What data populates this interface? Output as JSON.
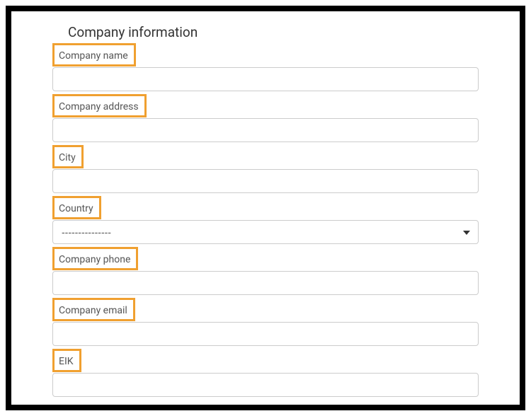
{
  "form": {
    "title": "Company information",
    "fields": {
      "company_name": {
        "label": "Company name",
        "value": ""
      },
      "company_address": {
        "label": "Company address",
        "value": ""
      },
      "city": {
        "label": "City",
        "value": ""
      },
      "country": {
        "label": "Country",
        "selected": "---------------"
      },
      "company_phone": {
        "label": "Company phone",
        "value": ""
      },
      "company_email": {
        "label": "Company email",
        "value": ""
      },
      "eik": {
        "label": "EIK",
        "value": ""
      }
    }
  }
}
